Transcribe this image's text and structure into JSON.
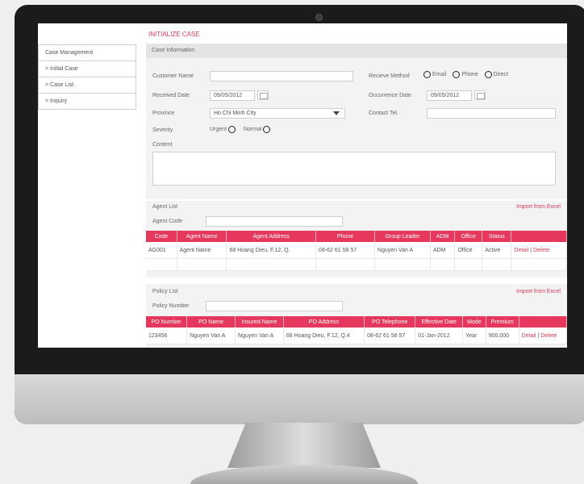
{
  "app": {
    "page_title": "INITIALIZE CASE"
  },
  "sidebar": {
    "items": [
      {
        "label": "Case Management"
      },
      {
        "label": "> Initial Case"
      },
      {
        "label": "> Case List"
      },
      {
        "label": "> Inquiry"
      }
    ]
  },
  "case_info": {
    "heading": "Case Information",
    "customer_name_label": "Customer Name",
    "customer_name_value": "",
    "receive_method_label": "Recieve Method",
    "receive_methods": [
      "Email",
      "Phone",
      "Direct"
    ],
    "received_date_label": "Received Date",
    "received_date_value": "09/05/2012",
    "occurrence_date_label": "Occurrence Date",
    "occurrence_date_value": "09/05/2012",
    "province_label": "Province",
    "province_value": "Ho Chi Minh City",
    "contact_tel_label": "Contact Tel.",
    "contact_tel_value": "",
    "severity_label": "Severity",
    "severity_options": [
      "Urgent",
      "Normal"
    ],
    "content_label": "Content"
  },
  "agent_list": {
    "heading": "Agent List",
    "import_label": "Import from Excel",
    "code_label": "Agent Code",
    "columns": [
      "Code",
      "Agent Name",
      "Agent Address",
      "Phone",
      "Group Leader",
      "ADM",
      "Office",
      "Status"
    ],
    "rows": [
      {
        "code": "AG001",
        "name": "Agent Name",
        "address": "68 Hoang Dieu, F.12, Q.",
        "phone": "08-62 61 58 57",
        "leader": "Nguyen Van A",
        "adm": "ADM",
        "office": "Office",
        "status": "Active",
        "detail": "Detail",
        "sep": "|",
        "delete": "Delete"
      }
    ]
  },
  "policy_list": {
    "heading": "Policy List",
    "import_label": "Import from Excel",
    "number_label": "Policy Number",
    "columns": [
      "PO Number",
      "PO Name",
      "Insured Name",
      "PO Address",
      "PO Telephone",
      "Effective Date",
      "Mode",
      "Premium"
    ],
    "rows": [
      {
        "number": "123456",
        "name": "Nguyen Van A",
        "insured": "Nguyen Van A",
        "address": "68 Hoang Dieu, F.12, Q.4",
        "tel": "08-62 61 58 57",
        "effective": "01-Jan-2012",
        "mode": "Year",
        "premium": "900.000",
        "detail": "Detail",
        "sep": "|",
        "delete": "Delete"
      }
    ]
  },
  "colors": {
    "accent": "#e6385c",
    "bezel": "#1b1b1b"
  }
}
